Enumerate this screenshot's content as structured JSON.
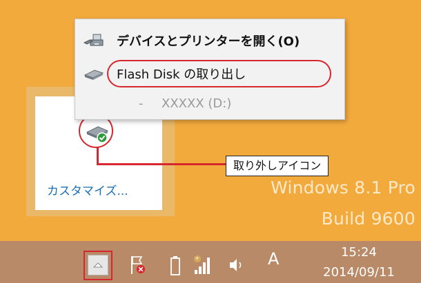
{
  "desktop": {
    "watermark_line1": "Windows 8.1 Pro",
    "watermark_line2": "Build 9600"
  },
  "overflow_panel": {
    "customize_label": "カスタマイズ..."
  },
  "context_menu": {
    "items": [
      {
        "label": "デバイスとプリンターを開く(O)",
        "icon": "devices-printers-icon"
      },
      {
        "label": "Flash Disk の取り出し",
        "icon": "usb-drive-icon"
      },
      {
        "dash": "-",
        "label": "XXXXX (D:)"
      }
    ]
  },
  "annotation": {
    "label": "取り外しアイコン"
  },
  "taskbar": {
    "icons": [
      "show-hidden-icons-button",
      "action-center-flag-icon",
      "battery-icon",
      "network-signal-icon",
      "volume-icon"
    ],
    "input_language": "A",
    "clock": {
      "time": "15:24",
      "date": "2014/09/11"
    }
  },
  "colors": {
    "desktop_bg": "#f3aa3d",
    "taskbar_bg": "#b98a67",
    "highlight_red": "#d6262e",
    "link_blue": "#1b6fb3"
  }
}
